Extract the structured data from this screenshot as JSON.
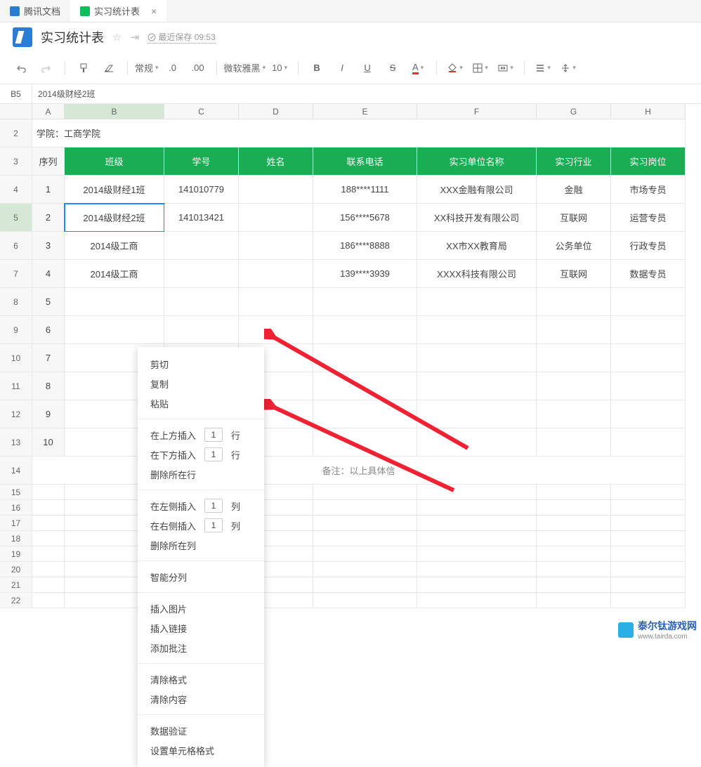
{
  "tabs": {
    "t1": "腾讯文档",
    "t2": "实习统计表"
  },
  "title": "实习统计表",
  "savetime": "最近保存 09:53",
  "toolbar": {
    "style": "常规",
    "decimal": ".0",
    "decimalAdd": ".00",
    "font": "微软雅黑",
    "size": "10"
  },
  "cellref": "B5",
  "cellval": "2014级财经2班",
  "cols": [
    "A",
    "B",
    "C",
    "D",
    "E",
    "F",
    "G",
    "H"
  ],
  "row2": "学院：工商学院",
  "headers": {
    "seq": "序列",
    "cls": "班级",
    "sid": "学号",
    "name": "姓名",
    "phone": "联系电话",
    "company": "实习单位名称",
    "industry": "实习行业",
    "job": "实习岗位"
  },
  "data": [
    {
      "n": "1",
      "cls": "2014级财经1班",
      "sid": "141010779",
      "name": "",
      "phone": "188****1111",
      "company": "XXX金融有限公司",
      "ind": "金融",
      "job": "市场专员"
    },
    {
      "n": "2",
      "cls": "2014级财经2班",
      "sid": "141013421",
      "name": "",
      "phone": "156****5678",
      "company": "XX科技开发有限公司",
      "ind": "互联网",
      "job": "运营专员"
    },
    {
      "n": "3",
      "cls": "2014级工商",
      "sid": "",
      "name": "",
      "phone": "186****8888",
      "company": "XX市XX教育局",
      "ind": "公务单位",
      "job": "行政专员"
    },
    {
      "n": "4",
      "cls": "2014级工商",
      "sid": "",
      "name": "",
      "phone": "139****3939",
      "company": "XXXX科技有限公司",
      "ind": "互联网",
      "job": "数据专员"
    }
  ],
  "emptyRows": [
    "5",
    "6",
    "7",
    "8",
    "9",
    "10"
  ],
  "footnote": "备注：以上具体信",
  "thinRows": [
    "15",
    "16",
    "17",
    "18",
    "19",
    "20",
    "21",
    "22"
  ],
  "ctx": {
    "cut": "剪切",
    "copy": "复制",
    "paste": "粘贴",
    "insAbove": "在上方插入",
    "insBelow": "在下方插入",
    "rowUnit": "行",
    "delRow": "删除所在行",
    "insLeft": "在左侧插入",
    "insRight": "在右侧插入",
    "colUnit": "列",
    "delCol": "删除所在列",
    "split": "智能分列",
    "insImg": "插入图片",
    "insLink": "插入链接",
    "addComment": "添加批注",
    "clearFmt": "清除格式",
    "clearContent": "清除内容",
    "validate": "数据验证",
    "cellFmt": "设置单元格格式",
    "one": "1"
  },
  "wm": {
    "name": "泰尔钛游戏网",
    "url": "www.tairda.com"
  }
}
